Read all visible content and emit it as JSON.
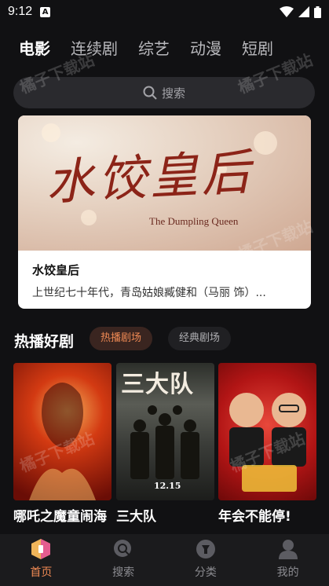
{
  "status": {
    "time": "9:12"
  },
  "tabs": [
    {
      "label": "电影"
    },
    {
      "label": "连续剧"
    },
    {
      "label": "综艺"
    },
    {
      "label": "动漫"
    },
    {
      "label": "短剧"
    }
  ],
  "search": {
    "placeholder": "搜索",
    "icon": "search-icon"
  },
  "banner": {
    "poster_title": "水饺皇后",
    "poster_subtitle": "The Dumpling Queen",
    "title": "水饺皇后",
    "description": "上世纪七十年代，青岛姑娘臧健和（马丽 饰）..."
  },
  "section": {
    "title": "热播好剧",
    "chips": [
      {
        "label": "热播剧场",
        "active": true
      },
      {
        "label": "经典剧场",
        "active": false
      }
    ]
  },
  "movies": [
    {
      "name": "哪吒之魔童闹海"
    },
    {
      "name": "三大队",
      "poster_text": "三大队",
      "poster_date": "12.15"
    },
    {
      "name": "年会不能停!"
    }
  ],
  "nav": [
    {
      "label": "首页",
      "icon": "home-icon",
      "active": true
    },
    {
      "label": "搜索",
      "icon": "search-icon",
      "active": false
    },
    {
      "label": "分类",
      "icon": "category-icon",
      "active": false
    },
    {
      "label": "我的",
      "icon": "user-icon",
      "active": false
    }
  ],
  "watermark": "橘子下载站",
  "colors": {
    "accent": "#f08a54",
    "background": "#111113"
  }
}
